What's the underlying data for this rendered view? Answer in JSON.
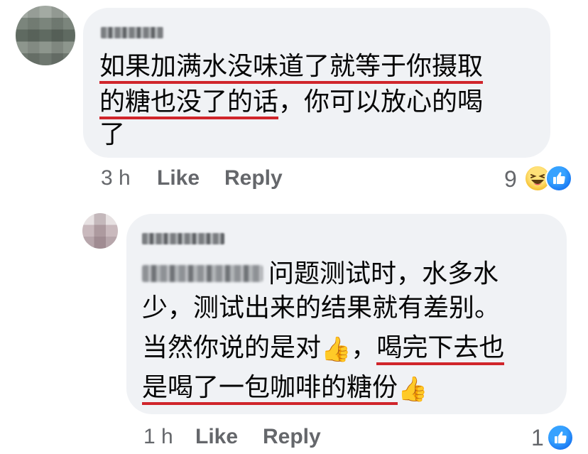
{
  "comments": [
    {
      "lines": [
        "如果加满水没味道了就等于你摄取",
        "的糖也没了的话",
        "，你可以放心的喝",
        "了"
      ],
      "time": "3 h",
      "like_label": "Like",
      "reply_label": "Reply",
      "reaction_count": "9",
      "reactions": [
        "haha-icon",
        "like-icon"
      ]
    },
    {
      "lines": [
        "问题测试时，水多水",
        "少，测试出来的结果就有差别。",
        "当然你说的是对",
        "，",
        "喝完下去也",
        "是喝了一包咖啡的糖份"
      ],
      "emoji": "👍",
      "time": "1 h",
      "like_label": "Like",
      "reply_label": "Reply",
      "reaction_count": "1",
      "reactions": [
        "like-icon"
      ]
    }
  ],
  "colors": {
    "bubble": "#f0f2f5",
    "meta_text": "#65676b",
    "underline": "#d0252b",
    "like_blue": "#1877f2",
    "haha_yellow": "#f7c53a"
  }
}
